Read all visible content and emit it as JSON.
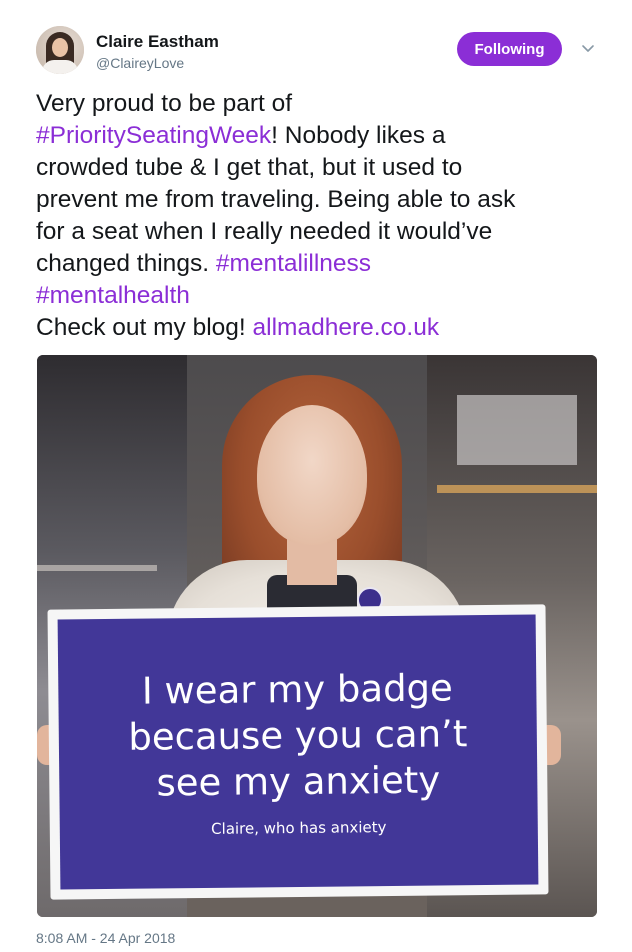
{
  "user": {
    "name": "Claire Eastham",
    "handle": "@ClaireyLove",
    "follow_label": "Following"
  },
  "colors": {
    "accent": "#8b2ed6",
    "text": "#14171a",
    "muted": "#657786",
    "sign": "#423798"
  },
  "tweet": {
    "line1": "Very proud to be part of",
    "hashtag_priority": "#PrioritySeatingWeek",
    "line2_rest": "! Nobody likes a",
    "line3": "crowded tube & I get that, but it used to",
    "line4": "prevent me from traveling. Being able to ask",
    "line5": "for a seat when I really needed it would’ve",
    "line6_text": "changed things. ",
    "hashtag_mentalillness": "#mentalillness",
    "hashtag_mentalhealth": "#mentalhealth",
    "line8_text": "Check out my blog! ",
    "link": "allmadhere.co.uk"
  },
  "photo": {
    "sign_line1": "I wear my badge",
    "sign_line2": "because you can’t",
    "sign_line3": "see my anxiety",
    "sign_caption": "Claire, who has anxiety"
  },
  "timestamp": "8:08 AM - 24 Apr 2018",
  "icons": {
    "more": "chevron-down-icon"
  }
}
